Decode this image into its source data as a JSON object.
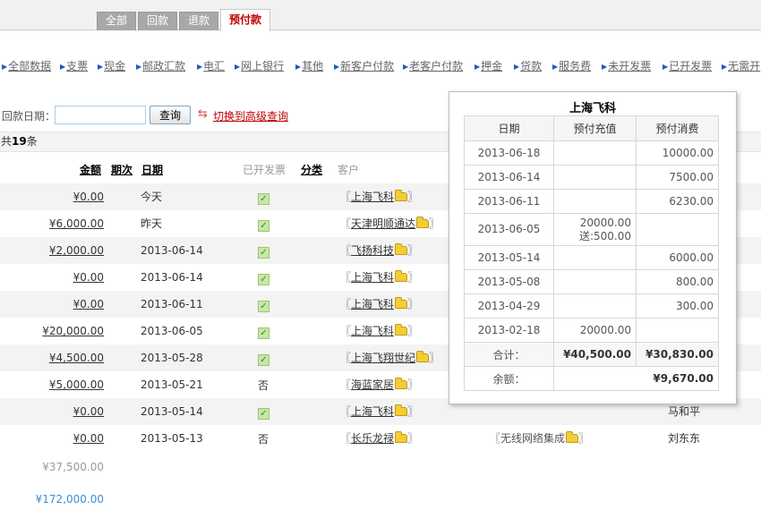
{
  "tabs": [
    {
      "label": "全部",
      "active": false
    },
    {
      "label": "回款",
      "active": false
    },
    {
      "label": "退款",
      "active": false
    },
    {
      "label": "预付款",
      "active": true
    }
  ],
  "filters": [
    "全部数据",
    "支票",
    "现金",
    "邮政汇款",
    "电汇",
    "网上银行",
    "其他",
    "新客户付款",
    "老客户付款",
    "押金",
    "贷款",
    "服务费",
    "未开发票",
    "已开发票",
    "无需开"
  ],
  "search": {
    "label": "回款日期：",
    "date_value": "",
    "query_button": "查询",
    "switch_link": "切换到高级查询"
  },
  "count": {
    "prefix": "共",
    "number": "19",
    "suffix": "条"
  },
  "columns": {
    "amount": "金额",
    "period": "期次",
    "date": "日期",
    "invoiced": "已开发票",
    "category": "分类",
    "customer": "客户"
  },
  "rows": [
    {
      "amount": "¥0.00",
      "date": "今天",
      "invoiced": true,
      "customer": "上海飞科",
      "sub": "",
      "contact": ""
    },
    {
      "amount": "¥6,000.00",
      "date": "昨天",
      "invoiced": true,
      "customer": "天津明顺通达",
      "sub": "",
      "contact": ""
    },
    {
      "amount": "¥2,000.00",
      "date": "2013-06-14",
      "invoiced": true,
      "customer": "飞扬科技",
      "sub": "",
      "contact": ""
    },
    {
      "amount": "¥0.00",
      "date": "2013-06-14",
      "invoiced": true,
      "customer": "上海飞科",
      "sub": "",
      "contact": ""
    },
    {
      "amount": "¥0.00",
      "date": "2013-06-11",
      "invoiced": true,
      "customer": "上海飞科",
      "sub": "",
      "contact": ""
    },
    {
      "amount": "¥20,000.00",
      "date": "2013-06-05",
      "invoiced": true,
      "customer": "上海飞科",
      "sub": "",
      "contact": ""
    },
    {
      "amount": "¥4,500.00",
      "date": "2013-05-28",
      "invoiced": true,
      "customer": "上海飞翔世纪",
      "sub": "",
      "contact": ""
    },
    {
      "amount": "¥5,000.00",
      "date": "2013-05-21",
      "invoiced": false,
      "invoiced_text": "否",
      "customer": "海蓝家居",
      "sub": "",
      "contact": ""
    },
    {
      "amount": "¥0.00",
      "date": "2013-05-14",
      "invoiced": true,
      "customer": "上海飞科",
      "sub": "",
      "contact": "马和平"
    },
    {
      "amount": "¥0.00",
      "date": "2013-05-13",
      "invoiced": false,
      "invoiced_text": "否",
      "customer": "长乐龙禄",
      "sub": "无线网络集成",
      "contact": "刘东东"
    }
  ],
  "totals": {
    "page_total": "¥37,500.00",
    "grand_total": "¥172,000.00"
  },
  "popup": {
    "title": "上海飞科",
    "headers": [
      "日期",
      "预付充值",
      "预付消费"
    ],
    "rows": [
      {
        "date": "2013-06-18",
        "recharge": "",
        "consume": "10000.00"
      },
      {
        "date": "2013-06-14",
        "recharge": "",
        "consume": "7500.00"
      },
      {
        "date": "2013-06-11",
        "recharge": "",
        "consume": "6230.00"
      },
      {
        "date": "2013-06-05",
        "recharge": "20000.00",
        "bonus": "送:500.00",
        "consume": ""
      },
      {
        "date": "2013-05-14",
        "recharge": "",
        "consume": "6000.00"
      },
      {
        "date": "2013-05-08",
        "recharge": "",
        "consume": "800.00"
      },
      {
        "date": "2013-04-29",
        "recharge": "",
        "consume": "300.00"
      },
      {
        "date": "2013-02-18",
        "recharge": "20000.00",
        "consume": ""
      }
    ],
    "sum_label": "合计：",
    "sum_recharge": "¥40,500.00",
    "sum_consume": "¥30,830.00",
    "balance_label": "余额：",
    "balance": "¥9,670.00"
  }
}
